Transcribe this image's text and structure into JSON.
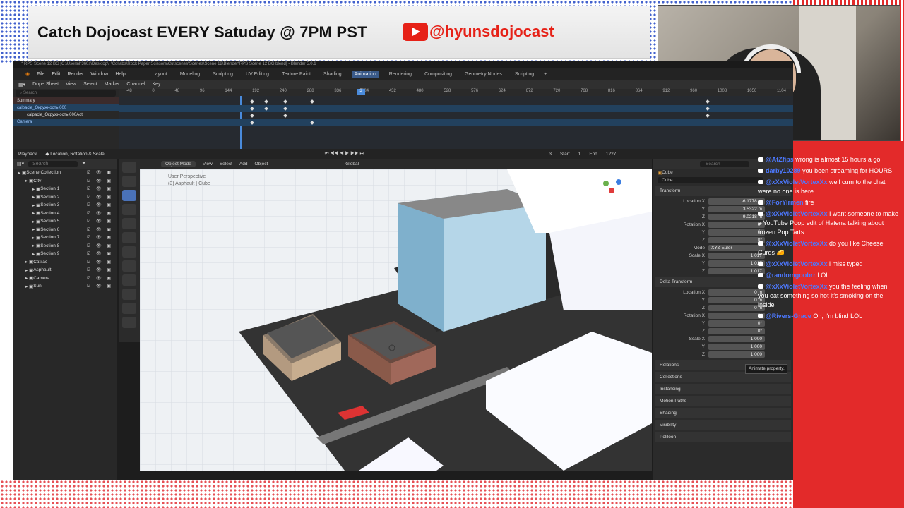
{
  "overlay": {
    "banner_text": "Catch Dojocast EVERY Satuday @ 7PM PST",
    "handle": "@hyunsdojocast"
  },
  "blender": {
    "title": "* RPS Scene 12 BG [C:\\Users\\h360s\\Desktop\\_\\Collabs\\Rock Paper Scissors\\Cutscenes\\Scenes\\Scene 12\\Blender\\RPS Scene 12 BG.blend] - Blender 5.0.1",
    "menu": [
      "File",
      "Edit",
      "Render",
      "Window",
      "Help"
    ],
    "workspaces": [
      "Layout",
      "Modeling",
      "Sculpting",
      "UV Editing",
      "Texture Paint",
      "Shading",
      "Animation",
      "Rendering",
      "Compositing",
      "Geometry Nodes",
      "Scripting"
    ],
    "active_workspace": "Animation",
    "dope_sheet": {
      "mode": "Dope Sheet",
      "menus": [
        "View",
        "Select",
        "Marker",
        "Channel",
        "Key"
      ],
      "search_placeholder": "Search",
      "frame_numbers": [
        "-48",
        "0",
        "48",
        "96",
        "144",
        "192",
        "240",
        "288",
        "336",
        "384",
        "432",
        "480",
        "528",
        "576",
        "624",
        "672",
        "720",
        "768",
        "816",
        "864",
        "912",
        "960",
        "1008",
        "1056",
        "1104"
      ],
      "current_frame": "3",
      "channels": [
        "Summary",
        "calpacle_Окружность.000",
        "calpacle_Окружность.000Act",
        "Camera"
      ]
    },
    "playback": {
      "label": "Playback",
      "keying": "Location, Rotation & Scale",
      "frame": "3",
      "start_label": "Start",
      "start": "1",
      "end_label": "End",
      "end": "1227"
    },
    "outliner": {
      "search_placeholder": "Search",
      "items": [
        {
          "label": "Scene Collection",
          "indent": 0
        },
        {
          "label": "City",
          "indent": 1
        },
        {
          "label": "Section 1",
          "indent": 2
        },
        {
          "label": "Section 2",
          "indent": 2
        },
        {
          "label": "Section 3",
          "indent": 2
        },
        {
          "label": "Section 4",
          "indent": 2
        },
        {
          "label": "Section 5",
          "indent": 2
        },
        {
          "label": "Section 6",
          "indent": 2
        },
        {
          "label": "Section 7",
          "indent": 2
        },
        {
          "label": "Section 8",
          "indent": 2
        },
        {
          "label": "Section 9",
          "indent": 2
        },
        {
          "label": "Catilac",
          "indent": 1
        },
        {
          "label": "Asphault",
          "indent": 1
        },
        {
          "label": "Camera",
          "indent": 1
        },
        {
          "label": "Sun",
          "indent": 1
        }
      ]
    },
    "viewport": {
      "mode": "Object Mode",
      "menus": [
        "View",
        "Select",
        "Add",
        "Object"
      ],
      "transform_orientation": "Global",
      "overlay_line1": "User Perspective",
      "overlay_line2": "(3) Asphault | Cube"
    },
    "properties": {
      "search_placeholder": "Search",
      "object_name": "Cube",
      "data_name": "Cube",
      "transform_label": "Transform",
      "location_label": "Location X",
      "location": [
        "-6.1778 m",
        "3.5322 m",
        "9.0218 m"
      ],
      "rotation_label": "Rotation X",
      "rotation": [
        "0°",
        "0°",
        "0°"
      ],
      "mode_label": "Mode",
      "mode": "XYZ Euler",
      "scale_label": "Scale X",
      "scale": [
        "1.017",
        "1.017",
        "1.017"
      ],
      "delta_label": "Delta Transform",
      "delta_location": [
        "0 m",
        "0 m",
        "0 m"
      ],
      "delta_rotation": [
        "0°",
        "0°",
        "0°"
      ],
      "delta_scale": [
        "1.000",
        "1.000",
        "1.000"
      ],
      "y_label": "Y",
      "z_label": "Z",
      "sections": [
        "Relations",
        "Collections",
        "Instancing",
        "Motion Paths",
        "Shading",
        "Visibility",
        "Poliloon"
      ],
      "tooltip": "Animate property.",
      "version": "5.0.1"
    }
  },
  "chat": [
    {
      "user": "@AtZfips",
      "text": "wrong is almost 15 hours a go"
    },
    {
      "user": "darby10289",
      "text": "you been streaming for HOURS"
    },
    {
      "user": "@xXxVioletVortexXx",
      "text": "well cum to the chat were no one is here"
    },
    {
      "user": "@ForYirmen",
      "text": "fire"
    },
    {
      "user": "@xXxVioletVortexXx",
      "text": "I want someone to make a YouTube Poop edit of Hatena talking about frozen Pop Tarts"
    },
    {
      "user": "@xXxVioletVortexXx",
      "text": "do you like Cheese Curds 🧀"
    },
    {
      "user": "@xXxVioletVortexXx",
      "text": "i miss typed"
    },
    {
      "user": "@randomgoobrr",
      "text": "LOL"
    },
    {
      "user": "@xXxVioletVortexXx",
      "text": "you the feeling when you eat something so hot it's smoking on the inside"
    },
    {
      "user": "@Rivers-Grace",
      "text": "Oh, I'm blind LOL"
    }
  ]
}
